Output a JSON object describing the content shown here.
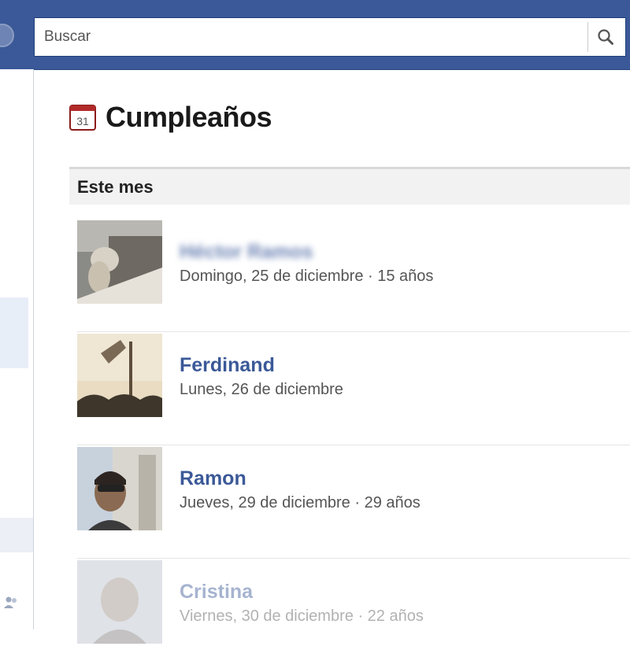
{
  "header": {
    "search_placeholder": "Buscar",
    "search_icon": "magnifier-icon"
  },
  "page": {
    "title": "Cumpleaños",
    "title_icon": "calendar-icon",
    "section_label": "Este mes"
  },
  "birthdays": [
    {
      "name": "Héctor Ramos",
      "date": "Domingo, 25 de diciembre",
      "age": "15 años",
      "name_blurred": true
    },
    {
      "name": "Ferdinand",
      "date": "Lunes, 26 de diciembre",
      "age": ""
    },
    {
      "name": "Ramon",
      "date": "Jueves, 29 de diciembre",
      "age": "29 años"
    },
    {
      "name": "Cristina",
      "date": "Viernes, 30 de diciembre",
      "age": "22 años",
      "faded": true
    }
  ],
  "colors": {
    "brand_blue": "#3b5998",
    "link_blue": "#3b5998",
    "meta_gray": "#555555"
  }
}
